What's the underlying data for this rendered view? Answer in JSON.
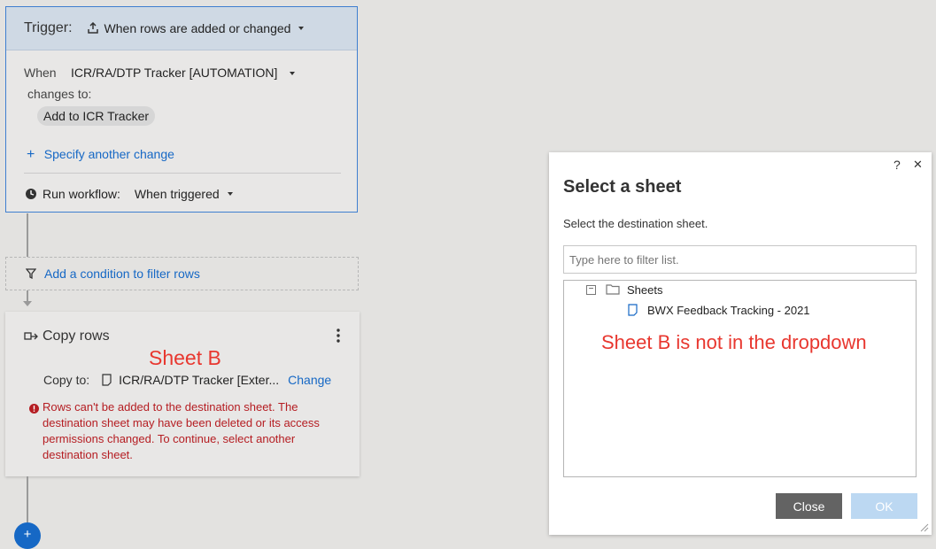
{
  "trigger": {
    "label": "Trigger:",
    "value": "When rows are added or changed",
    "when_label": "When",
    "when_value": "ICR/RA/DTP Tracker [AUTOMATION]",
    "changes_to_label": "changes to:",
    "chip_value": "Add to ICR Tracker",
    "specify_link": "Specify another change",
    "run_label": "Run workflow:",
    "run_value": "When triggered"
  },
  "filter": {
    "link": "Add a condition to filter rows"
  },
  "copy_rows": {
    "title": "Copy rows",
    "annotation": "Sheet B",
    "copy_to_label": "Copy to:",
    "sheet_name": "ICR/RA/DTP Tracker [Exter...",
    "change_link": "Change",
    "error": "Rows can't be added to the destination sheet. The destination sheet may have been deleted or its access permissions changed. To continue, select another destination sheet."
  },
  "dialog": {
    "help": "?",
    "close_x": "✕",
    "title": "Select a sheet",
    "subtitle": "Select the destination sheet.",
    "filter_placeholder": "Type here to filter list.",
    "tree_toggle": "−",
    "folder_label": "Sheets",
    "sheet_item": "BWX Feedback Tracking - 2021",
    "annotation": "Sheet B is not in the dropdown",
    "close_button": "Close",
    "ok_button": "OK"
  },
  "colors": {
    "accent": "#1668c5",
    "error": "#b51d22",
    "annotation": "#e8372f"
  }
}
